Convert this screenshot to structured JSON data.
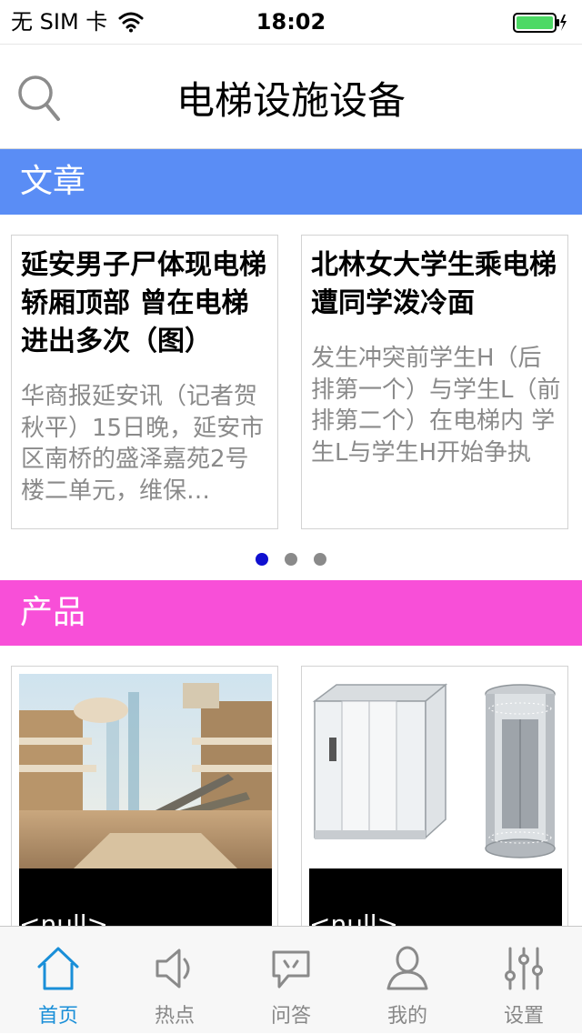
{
  "status_bar": {
    "carrier": "无 SIM 卡",
    "time": "18:02",
    "battery_color": "#4cd964"
  },
  "nav": {
    "title": "电梯设施设备",
    "search_icon": "search-icon"
  },
  "sections": {
    "articles": {
      "label": "文章",
      "color": "#5a8df5"
    },
    "products": {
      "label": "产品",
      "color": "#f84fd8"
    }
  },
  "articles": [
    {
      "title": "延安男子尸体现电梯轿厢顶部 曾在电梯进出多次（图）",
      "summary": "华商报延安讯（记者贺秋平）15日晚，延安市区南桥的盛泽嘉苑2号楼二单元，维保…"
    },
    {
      "title": "北林女大学生乘电梯遭同学泼冷面",
      "summary": "发生冲突前学生H（后排第一个）与学生L（前排第二个）在电梯内 学生L与学生H开始争执 学生L向学生…"
    }
  ],
  "pagination": {
    "count": 3,
    "active_index": 0,
    "active_color": "#1010d0",
    "inactive_color": "#8a8a8a"
  },
  "products": [
    {
      "label": "<null>",
      "image": "mall-atrium-escalators-photo"
    },
    {
      "label": "<null>",
      "image": "glass-elevator-cabins-photo"
    }
  ],
  "tabs": [
    {
      "label": "首页",
      "icon": "home-icon",
      "active": true
    },
    {
      "label": "热点",
      "icon": "speaker-icon",
      "active": false
    },
    {
      "label": "问答",
      "icon": "chat-bubble-icon",
      "active": false
    },
    {
      "label": "我的",
      "icon": "user-icon",
      "active": false
    },
    {
      "label": "设置",
      "icon": "sliders-icon",
      "active": false
    }
  ],
  "colors": {
    "tab_active": "#1a8fd8",
    "tab_inactive": "#888888"
  }
}
